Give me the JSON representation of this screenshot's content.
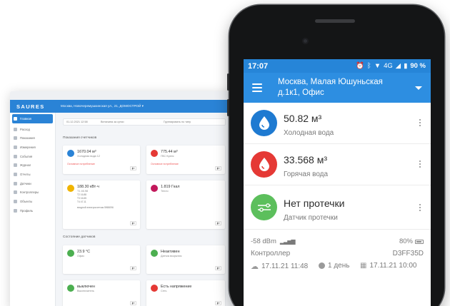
{
  "desktop": {
    "logo": "SAURES",
    "address": "Москва, Новочеремушкинская ул., 21, ДОМОСТРОЙ ▾",
    "filter_date": "01.12.2021 12:58",
    "filter_period": "Величина за сутки",
    "filter_group": "Группировать по типу",
    "sidebar": [
      {
        "label": "Главная",
        "active": true
      },
      {
        "label": "Расход"
      },
      {
        "label": "Показания"
      },
      {
        "label": "Измерения"
      },
      {
        "label": "События"
      },
      {
        "label": "Журнал"
      },
      {
        "label": "Отчеты"
      },
      {
        "label": "Датчики"
      },
      {
        "label": "Контроллеры"
      },
      {
        "label": "Объекты"
      },
      {
        "label": "Профиль"
      }
    ],
    "section_meters": "Показания счетчиков",
    "section_sensors": "Состояние датчиков",
    "meters": [
      {
        "value": "1670.04 м³",
        "sub": "Холодная вода 12",
        "warn": "Основное потребление",
        "color": "#2a83d6"
      },
      {
        "value": "775.44 м³",
        "sub": "ГВС Кухня",
        "warn": "Основное потребление",
        "color": "#e53935"
      },
      {
        "value": "188.30 кВт·ч",
        "sub": "Т1 46.98",
        "extra": [
          "Т2 16.88",
          "Т3 16.65",
          "Т4 47.11",
          "входной электросчетчик 5965096"
        ],
        "color": "#f0b400"
      },
      {
        "value": "1.819 Гкал",
        "sub": "Тепло",
        "color": "#c2185b"
      }
    ],
    "sensors": [
      {
        "value": "23.9 °C",
        "sub": "Офис",
        "color": "#4caf50"
      },
      {
        "value": "Неактивен",
        "sub": "Датчик вскрытия",
        "color": "#4caf50"
      },
      {
        "value": "выключен",
        "sub": "Выключатель",
        "color": "#4caf50"
      },
      {
        "value": "Есть напряжение",
        "sub": "Сеть",
        "color": "#e53935"
      }
    ]
  },
  "phone": {
    "status": {
      "time": "17:07",
      "network": "4G",
      "battery": "90 %"
    },
    "appbar": {
      "title_line1": "Москва, Малая Юшуньская",
      "title_line2": "д.1к1, Офис"
    },
    "rows": [
      {
        "value": "50.82 м³",
        "label": "Холодная вода",
        "icon": "water-drop-icon",
        "color": "#1e7ad1"
      },
      {
        "value": "33.568 м³",
        "label": "Горячая вода",
        "icon": "water-drop-icon",
        "color": "#e53935"
      },
      {
        "value": "Нет протечки",
        "label": "Датчик протечки",
        "icon": "leak-sensor-icon",
        "color": "#5cbf5c"
      }
    ],
    "controller": {
      "signal": "-58 dBm",
      "battery": "80%",
      "label": "Контроллер",
      "serial": "D3FF35D",
      "last_sync": "17.11.21 11:48",
      "period": "1 день",
      "next_sync": "17.11.21 10:00"
    }
  }
}
